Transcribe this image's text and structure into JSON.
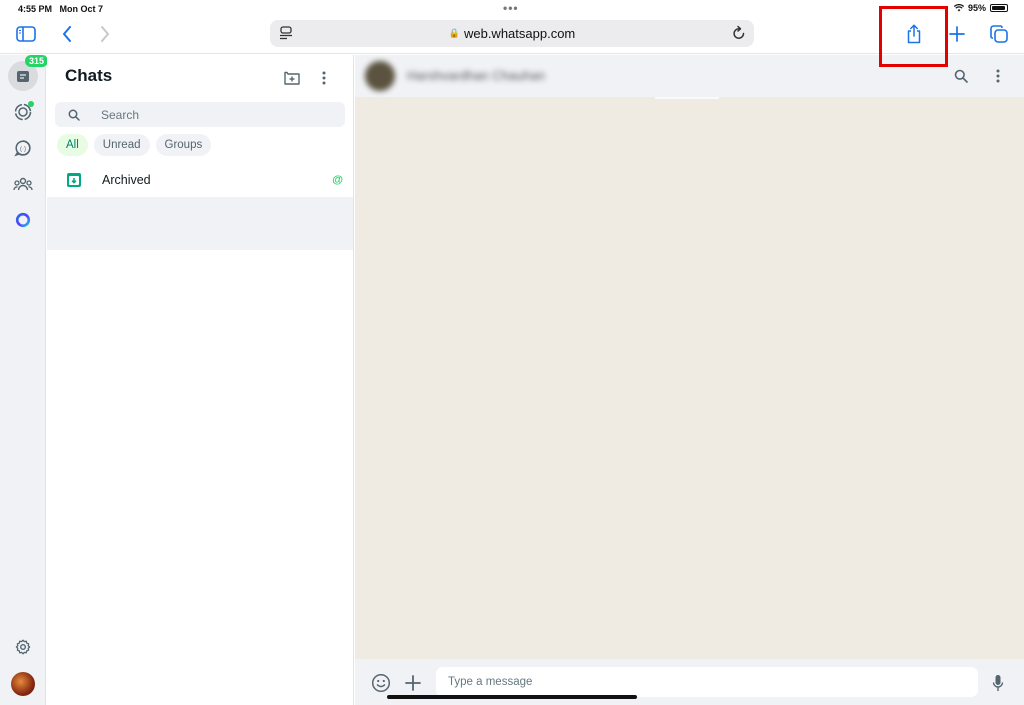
{
  "status_bar": {
    "time": "4:55 PM",
    "date": "Mon Oct 7",
    "battery": "95%",
    "battery_level": 0.95
  },
  "browser": {
    "url": "web.whatsapp.com",
    "icons": {
      "sidebar": "sidebar-toggle-icon",
      "back": "chevron-left-icon",
      "forward": "chevron-right-icon",
      "reader": "reader-mode-icon",
      "reload": "reload-icon",
      "share": "share-icon",
      "new_tab": "plus-icon",
      "tabs": "tabs-overview-icon"
    },
    "highlight_color": "#e50000"
  },
  "rail": {
    "chats_badge": "315",
    "items": [
      "chats",
      "status",
      "channels",
      "communities",
      "meta-ai"
    ],
    "bottom": [
      "settings",
      "profile"
    ]
  },
  "sidebar": {
    "title": "Chats",
    "search_placeholder": "Search",
    "filters": [
      {
        "label": "All",
        "active": true
      },
      {
        "label": "Unread",
        "active": false
      },
      {
        "label": "Groups",
        "active": false
      }
    ],
    "archived_label": "Archived",
    "archived_mention": "@"
  },
  "chat": {
    "contact_name": "Harshvardhan Chauhan",
    "input_placeholder": "Type a message"
  },
  "colors": {
    "accent": "#25d366",
    "accent_dark": "#008069",
    "safari_blue": "#1a73e8",
    "chat_bg": "#efeae2",
    "panel_bg": "#f0f2f5"
  }
}
